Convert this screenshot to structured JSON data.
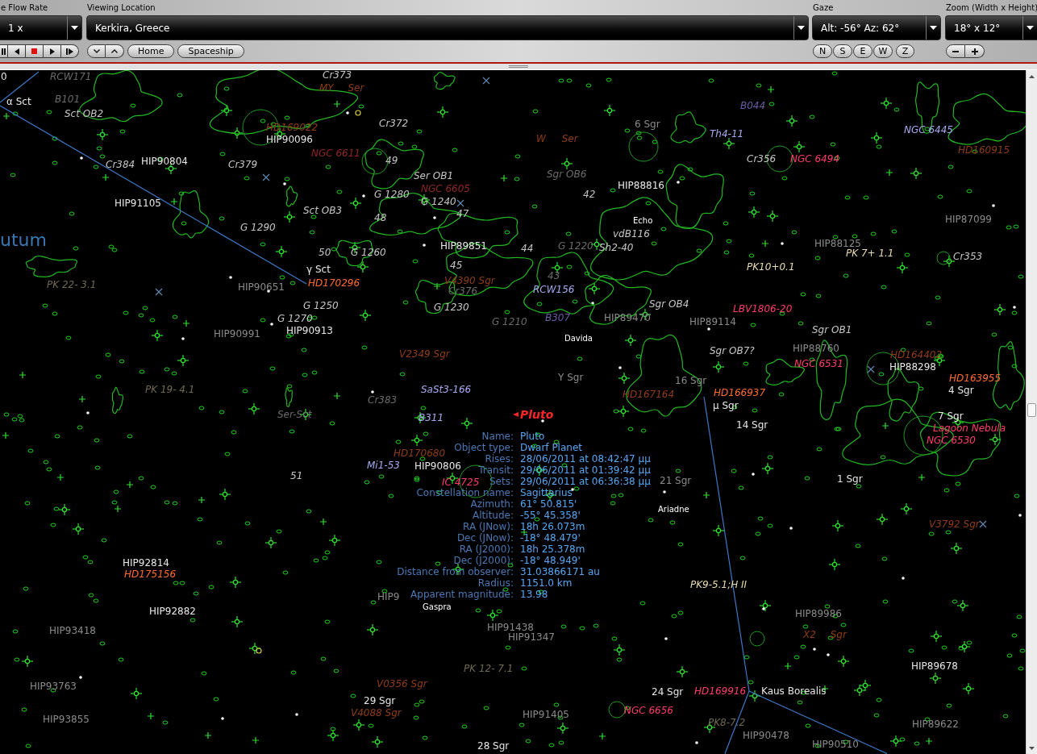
{
  "toolbar": {
    "fields": [
      {
        "label": "e Flow Rate",
        "value": "1 x"
      },
      {
        "label": "Viewing Location",
        "value": "Kerkira, Greece"
      },
      {
        "label": "Gaze",
        "value": "Alt: -56° Az: 62°"
      },
      {
        "label": "Zoom (Width x Height)",
        "value": "18° x 12°"
      }
    ],
    "nav_buttons": [
      "Home",
      "Spaceship"
    ],
    "direction_buttons": [
      "N",
      "S",
      "E",
      "W"
    ],
    "reset_button": "Z"
  },
  "sky_labels": [
    {
      "text": "0",
      "kind": "star",
      "faint": false
    },
    {
      "text": "RCW171",
      "kind": "cluster",
      "faint": true
    },
    {
      "text": "Cr373",
      "kind": "cluster",
      "faint": false
    },
    {
      "text": "MY Ser",
      "kind": "variable",
      "faint": true
    },
    {
      "text": "α Sct",
      "kind": "star",
      "faint": false
    },
    {
      "text": "B101",
      "kind": "cluster",
      "faint": true
    },
    {
      "text": "B044",
      "kind": "dark",
      "faint": true
    },
    {
      "text": "Sct OB2",
      "kind": "cluster",
      "faint": false
    },
    {
      "text": "HD169022",
      "kind": "variable",
      "faint": true
    },
    {
      "text": "Cr372",
      "kind": "cluster",
      "faint": false
    },
    {
      "text": "6 Sgr",
      "kind": "star",
      "faint": true
    },
    {
      "text": "Th4-11",
      "kind": "dark",
      "faint": false
    },
    {
      "text": "NGC 6445",
      "kind": "dark",
      "faint": false
    },
    {
      "text": "HIP90096",
      "kind": "star",
      "faint": false
    },
    {
      "text": "W Ser",
      "kind": "variable",
      "faint": true
    },
    {
      "text": "NGC 6611",
      "kind": "emission",
      "faint": true
    },
    {
      "text": "HD160915",
      "kind": "variable",
      "faint": true
    },
    {
      "text": "Cr384",
      "kind": "cluster",
      "faint": false
    },
    {
      "text": "HIP90804",
      "kind": "star",
      "faint": false
    },
    {
      "text": "Cr379",
      "kind": "cluster",
      "faint": false
    },
    {
      "text": "49",
      "kind": "cluster",
      "faint": false
    },
    {
      "text": "Cr356",
      "kind": "cluster",
      "faint": false
    },
    {
      "text": "NGC 6494",
      "kind": "emission",
      "faint": false
    },
    {
      "text": "Ser OB1",
      "kind": "cluster",
      "faint": false
    },
    {
      "text": "Sgr OB6",
      "kind": "cluster",
      "faint": true
    },
    {
      "text": "NGC 6605",
      "kind": "emission",
      "faint": true
    },
    {
      "text": "HIP88816",
      "kind": "star",
      "faint": false
    },
    {
      "text": "G 1280",
      "kind": "cluster",
      "faint": false
    },
    {
      "text": "42",
      "kind": "cluster",
      "faint": false
    },
    {
      "text": "HIP91105",
      "kind": "star",
      "faint": false
    },
    {
      "text": "G 1240",
      "kind": "cluster",
      "faint": false
    },
    {
      "text": "Sct OB3",
      "kind": "cluster",
      "faint": false
    },
    {
      "text": "48",
      "kind": "cluster",
      "faint": false
    },
    {
      "text": "47",
      "kind": "cluster",
      "faint": false
    },
    {
      "text": "Echo",
      "kind": "asteroid",
      "faint": false
    },
    {
      "text": "HIP87099",
      "kind": "star",
      "faint": true
    },
    {
      "text": "G 1290",
      "kind": "cluster",
      "faint": false
    },
    {
      "text": "utum",
      "kind": "constellation",
      "faint": false
    },
    {
      "text": "vdB116",
      "kind": "cluster",
      "faint": false
    },
    {
      "text": "HIP89851",
      "kind": "star",
      "faint": false
    },
    {
      "text": "44",
      "kind": "cluster",
      "faint": false
    },
    {
      "text": "G 1220",
      "kind": "cluster",
      "faint": true
    },
    {
      "text": "Sh2-40",
      "kind": "cluster",
      "faint": false
    },
    {
      "text": "HIP88125",
      "kind": "star",
      "faint": true
    },
    {
      "text": "50",
      "kind": "cluster",
      "faint": false
    },
    {
      "text": "G 1260",
      "kind": "cluster",
      "faint": false
    },
    {
      "text": "PK 7+ 1.1",
      "kind": "planetary",
      "faint": false
    },
    {
      "text": "Cr353",
      "kind": "cluster",
      "faint": false
    },
    {
      "text": "γ Sct",
      "kind": "star",
      "faint": false
    },
    {
      "text": "45",
      "kind": "cluster",
      "faint": false
    },
    {
      "text": "PK10+0.1",
      "kind": "planetary",
      "faint": false
    },
    {
      "text": "43",
      "kind": "cluster",
      "faint": true
    },
    {
      "text": "PK 22- 3.1",
      "kind": "planetary",
      "faint": true
    },
    {
      "text": "HIP90651",
      "kind": "star",
      "faint": true
    },
    {
      "text": "HD170296",
      "kind": "variable",
      "faint": false
    },
    {
      "text": "V4390 Sgr",
      "kind": "variable",
      "faint": true
    },
    {
      "text": "Cr376",
      "kind": "cluster",
      "faint": true
    },
    {
      "text": "RCW156",
      "kind": "dark",
      "faint": false
    },
    {
      "text": "G 1250",
      "kind": "cluster",
      "faint": false
    },
    {
      "text": "G 1230",
      "kind": "cluster",
      "faint": false
    },
    {
      "text": "Sgr OB4",
      "kind": "cluster",
      "faint": false
    },
    {
      "text": "LBV1806-20",
      "kind": "emission",
      "faint": false
    },
    {
      "text": "G 1270",
      "kind": "cluster",
      "faint": false
    },
    {
      "text": "G 1210",
      "kind": "cluster",
      "faint": true
    },
    {
      "text": "B307",
      "kind": "dark",
      "faint": true
    },
    {
      "text": "HIP89470",
      "kind": "star",
      "faint": true
    },
    {
      "text": "HIP89114",
      "kind": "star",
      "faint": true
    },
    {
      "text": "HIP90991",
      "kind": "star",
      "faint": true
    },
    {
      "text": "HIP90913",
      "kind": "star",
      "faint": false
    },
    {
      "text": "Sgr OB1",
      "kind": "cluster",
      "faint": false
    },
    {
      "text": "Davida",
      "kind": "asteroid",
      "faint": false
    },
    {
      "text": "V2349 Sgr",
      "kind": "variable",
      "faint": true
    },
    {
      "text": "Sgr OB7?",
      "kind": "cluster",
      "faint": false
    },
    {
      "text": "HIP88760",
      "kind": "star",
      "faint": true
    },
    {
      "text": "HD164402",
      "kind": "variable",
      "faint": true
    },
    {
      "text": "NGC 6531",
      "kind": "emission",
      "faint": false
    },
    {
      "text": "HIP88298",
      "kind": "star",
      "faint": false
    },
    {
      "text": "Y Sgr",
      "kind": "star",
      "faint": true
    },
    {
      "text": "16 Sgr",
      "kind": "star",
      "faint": true
    },
    {
      "text": "HD163955",
      "kind": "variable",
      "faint": false
    },
    {
      "text": "PK 19- 4.1",
      "kind": "planetary",
      "faint": true
    },
    {
      "text": "SaSt3-166",
      "kind": "dark",
      "faint": false
    },
    {
      "text": "HD167164",
      "kind": "variable",
      "faint": true
    },
    {
      "text": "HD166937",
      "kind": "variable",
      "faint": false
    },
    {
      "text": "4 Sgr",
      "kind": "star",
      "faint": false
    },
    {
      "text": "Cr383",
      "kind": "cluster",
      "faint": true
    },
    {
      "text": "μ Sgr",
      "kind": "star",
      "faint": false
    },
    {
      "text": "Ser-Sct",
      "kind": "cluster",
      "faint": true
    },
    {
      "text": "B311",
      "kind": "dark",
      "faint": false
    },
    {
      "text": "Pluto",
      "kind": "planet",
      "faint": false
    },
    {
      "text": "7 Sgr",
      "kind": "star",
      "faint": false
    },
    {
      "text": "14 Sgr",
      "kind": "star",
      "faint": false
    },
    {
      "text": "Lagoon Nebula",
      "kind": "emission",
      "faint": false
    },
    {
      "text": "NGC 6530",
      "kind": "emission",
      "faint": false
    },
    {
      "text": "HD170680",
      "kind": "variable",
      "faint": true
    },
    {
      "text": "Mi1-53",
      "kind": "dark",
      "faint": false
    },
    {
      "text": "HIP90806",
      "kind": "star",
      "faint": false
    },
    {
      "text": "51",
      "kind": "cluster",
      "faint": false
    },
    {
      "text": "IC 4725",
      "kind": "emission",
      "faint": false
    },
    {
      "text": "21 Sgr",
      "kind": "star",
      "faint": true
    },
    {
      "text": "1 Sgr",
      "kind": "star",
      "faint": false
    },
    {
      "text": "Ariadne",
      "kind": "asteroid",
      "faint": false
    },
    {
      "text": "V3792 Sgr",
      "kind": "variable",
      "faint": true
    },
    {
      "text": "HIP92814",
      "kind": "star",
      "faint": false
    },
    {
      "text": "HD175156",
      "kind": "variable",
      "faint": false
    },
    {
      "text": "PK9-5.1;H II",
      "kind": "planetary",
      "faint": false
    },
    {
      "text": "HIP9",
      "kind": "star",
      "faint": true
    },
    {
      "text": "HIP92882",
      "kind": "star",
      "faint": false
    },
    {
      "text": "Gaspra",
      "kind": "asteroid",
      "faint": false
    },
    {
      "text": "HIP89986",
      "kind": "star",
      "faint": true
    },
    {
      "text": "HIP93418",
      "kind": "star",
      "faint": true
    },
    {
      "text": "HIP91438",
      "kind": "star",
      "faint": true
    },
    {
      "text": "HIP91347",
      "kind": "star",
      "faint": true
    },
    {
      "text": "X2 Sgr",
      "kind": "variable",
      "faint": true
    },
    {
      "text": "PK 12- 7.1",
      "kind": "planetary",
      "faint": true
    },
    {
      "text": "HIP89678",
      "kind": "star",
      "faint": false
    },
    {
      "text": "HIP93763",
      "kind": "star",
      "faint": true
    },
    {
      "text": "V0356 Sgr",
      "kind": "variable",
      "faint": true
    },
    {
      "text": "24 Sgr",
      "kind": "star",
      "faint": false
    },
    {
      "text": "HD169916",
      "kind": "emission",
      "faint": false
    },
    {
      "text": "Kaus Borealis",
      "kind": "star",
      "faint": false
    },
    {
      "text": "29 Sgr",
      "kind": "star",
      "faint": false
    },
    {
      "text": "V4088 Sgr",
      "kind": "variable",
      "faint": true
    },
    {
      "text": "HIP91405",
      "kind": "star",
      "faint": true
    },
    {
      "text": "NGC 6656",
      "kind": "emission",
      "faint": false
    },
    {
      "text": "HIP93855",
      "kind": "star",
      "faint": true
    },
    {
      "text": "PK8-7.2",
      "kind": "planetary",
      "faint": true
    },
    {
      "text": "HIP89622",
      "kind": "star",
      "faint": true
    },
    {
      "text": "HIP90478",
      "kind": "star",
      "faint": true
    },
    {
      "text": "28 Sgr",
      "kind": "star",
      "faint": false
    },
    {
      "text": "HIP90510",
      "kind": "star",
      "faint": true
    }
  ],
  "info_panel": [
    {
      "label": "Name:",
      "value": "Pluto"
    },
    {
      "label": "Object type:",
      "value": "Dwarf Planet"
    },
    {
      "label": "Rises:",
      "value": "28/06/2011 at 08:42:47 μμ"
    },
    {
      "label": "Transit:",
      "value": "29/06/2011 at 01:39:42 μμ"
    },
    {
      "label": "Sets:",
      "value": "29/06/2011 at 06:36:38 μμ"
    },
    {
      "label": "Constellation name:",
      "value": "Sagittarius"
    },
    {
      "label": "Azimuth:",
      "value": "61° 50.815'"
    },
    {
      "label": "Altitude:",
      "value": "-55° 45.358'"
    },
    {
      "label": "RA (JNow):",
      "value": "18h 26.073m"
    },
    {
      "label": "Dec (JNow):",
      "value": "-18° 48.479'"
    },
    {
      "label": "RA (J2000):",
      "value": "18h 25.378m"
    },
    {
      "label": "Dec (J2000):",
      "value": "-18° 48.949'"
    },
    {
      "label": "Distance from observer:",
      "value": "31.03866171 au"
    },
    {
      "label": "Radius:",
      "value": "1151.0 km"
    },
    {
      "label": "Apparent magnitude:",
      "value": "13.98"
    }
  ]
}
